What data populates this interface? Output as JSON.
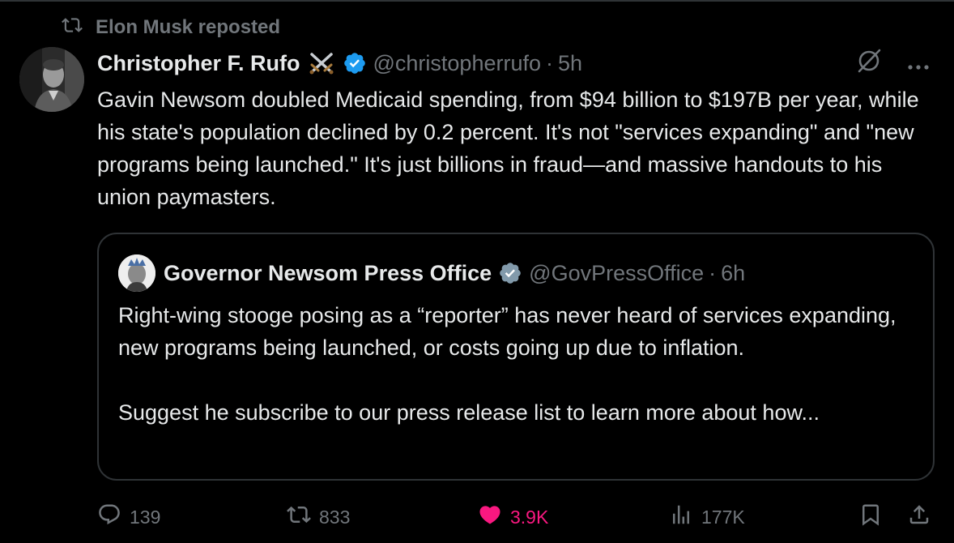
{
  "repost": {
    "label": "Elon Musk reposted"
  },
  "tweet": {
    "author_name": "Christopher F. Rufo",
    "handle": "@christopherrufo",
    "separator": "·",
    "time": "5h",
    "text": "Gavin Newsom doubled Medicaid spending, from $94 billion to $197B per year, while his state's population declined by 0.2 percent. It's not \"services expanding\" and \"new programs being launched.\" It's just billions in fraud—and massive handouts to his union paymasters.",
    "badge_icon": "crossed-swords-icon",
    "verified_icon": "verified-badge-icon"
  },
  "quote": {
    "author_name": "Governor Newsom Press Office",
    "handle": "@GovPressOffice",
    "separator": "·",
    "time": "6h",
    "paragraph_1": "Right-wing stooge posing as a “reporter” has never heard of services expanding, new programs being launched, or costs going up due to inflation.",
    "paragraph_2": "Suggest he subscribe to our press release list to learn more about how..."
  },
  "metrics": {
    "replies": "139",
    "reposts": "833",
    "likes": "3.9K",
    "views": "177K"
  },
  "colors": {
    "background": "#000000",
    "text_primary": "#e7e9ea",
    "text_secondary": "#71767b",
    "verified_blue": "#1d9bf0",
    "like_pink": "#f91880",
    "border": "#2f3336"
  }
}
